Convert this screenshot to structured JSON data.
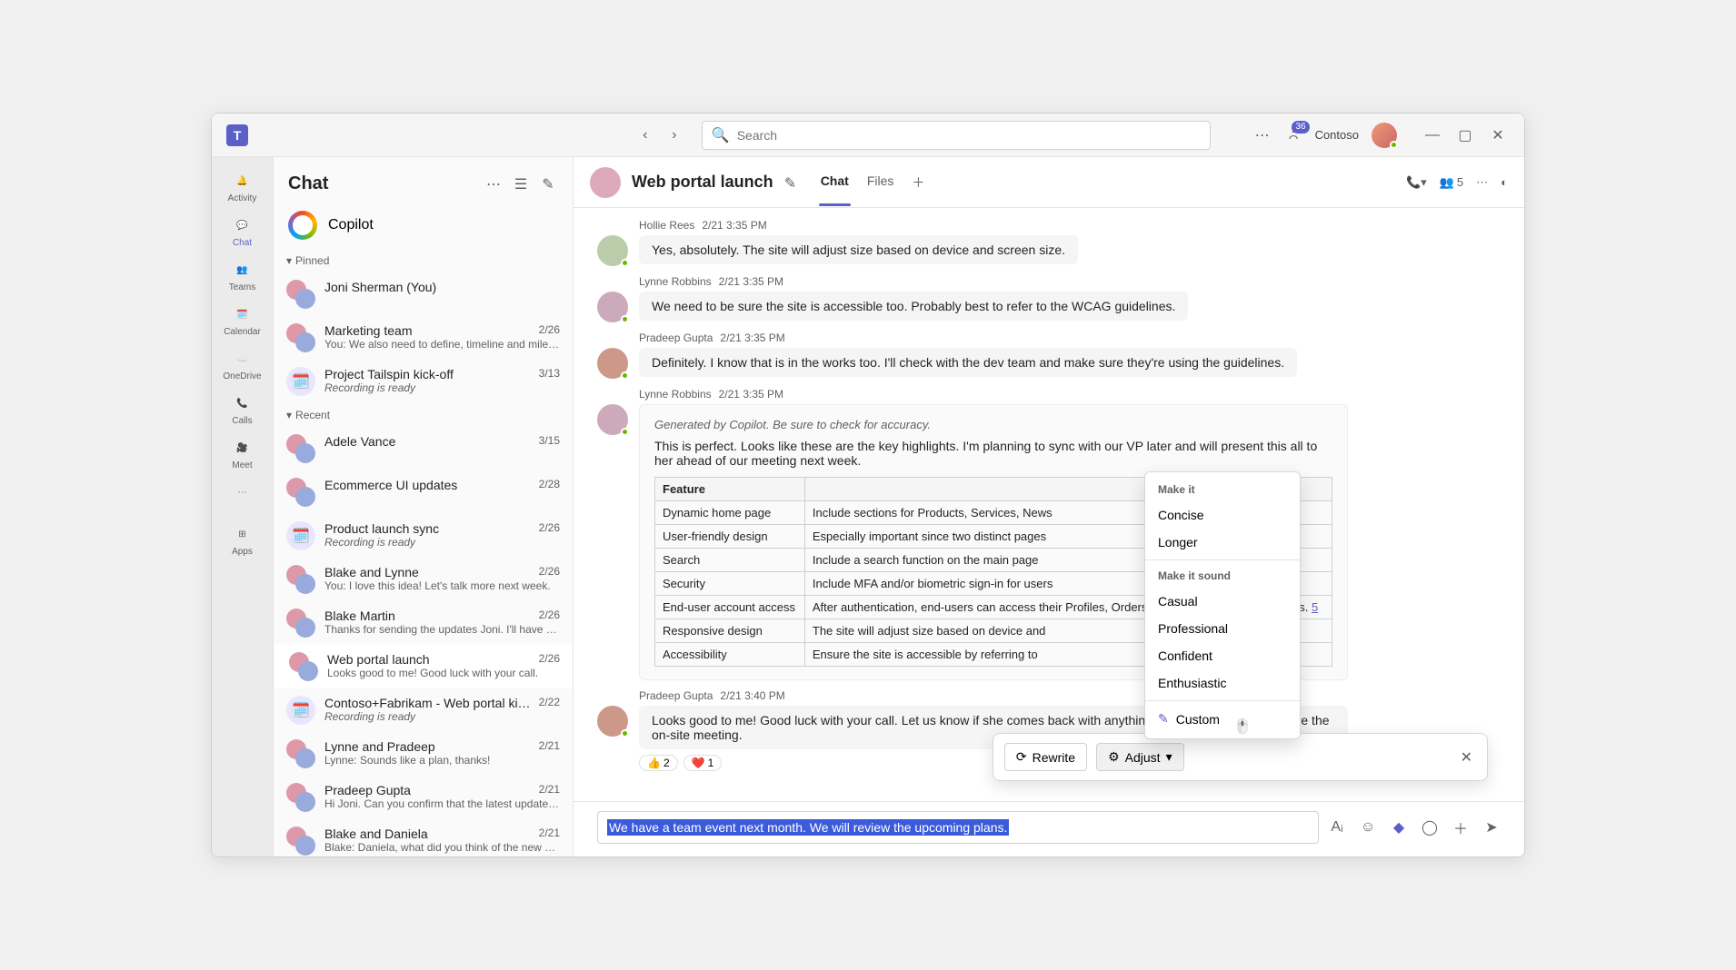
{
  "titlebar": {
    "search_placeholder": "Search",
    "tenant": "Contoso",
    "badge_count": "36"
  },
  "rail": {
    "activity": "Activity",
    "chat": "Chat",
    "teams": "Teams",
    "calendar": "Calendar",
    "onedrive": "OneDrive",
    "calls": "Calls",
    "meet": "Meet",
    "apps": "Apps"
  },
  "chatlist": {
    "title": "Chat",
    "copilot": "Copilot",
    "section_pinned": "Pinned",
    "section_recent": "Recent",
    "pinned": [
      {
        "title": "Joni Sherman (You)",
        "date": "",
        "sub": ""
      },
      {
        "title": "Marketing team",
        "date": "2/26",
        "sub": "You: We also need to define, timeline and miles…"
      },
      {
        "title": "Project Tailspin kick-off",
        "date": "3/13",
        "sub": "Recording is ready",
        "italic": true,
        "cal": true
      }
    ],
    "recent": [
      {
        "title": "Adele Vance",
        "date": "3/15",
        "sub": ""
      },
      {
        "title": "Ecommerce UI updates",
        "date": "2/28",
        "sub": ""
      },
      {
        "title": "Product launch sync",
        "date": "2/26",
        "sub": "Recording is ready",
        "italic": true,
        "cal": true
      },
      {
        "title": "Blake and Lynne",
        "date": "2/26",
        "sub": "You: I love this idea! Let's talk more next week."
      },
      {
        "title": "Blake Martin",
        "date": "2/26",
        "sub": "Thanks for sending the updates Joni. I'll have s…"
      },
      {
        "title": "Web portal launch",
        "date": "2/26",
        "sub": "Looks good to me! Good luck with your call.",
        "selected": true
      },
      {
        "title": "Contoso+Fabrikam - Web portal ki…",
        "date": "2/22",
        "sub": "Recording is ready",
        "italic": true,
        "cal": true
      },
      {
        "title": "Lynne and Pradeep",
        "date": "2/21",
        "sub": "Lynne: Sounds like a plan, thanks!"
      },
      {
        "title": "Pradeep Gupta",
        "date": "2/21",
        "sub": "Hi Joni. Can you confirm that the latest updates…"
      },
      {
        "title": "Blake and Daniela",
        "date": "2/21",
        "sub": "Blake: Daniela, what did you think of the new d…"
      }
    ]
  },
  "chat": {
    "title": "Web portal launch",
    "tab_chat": "Chat",
    "tab_files": "Files",
    "participants_count": "5"
  },
  "messages": [
    {
      "author": "Hollie Rees",
      "time": "2/21 3:35 PM",
      "text": "Yes, absolutely. The site will adjust size based on device and screen size."
    },
    {
      "author": "Lynne Robbins",
      "time": "2/21 3:35 PM",
      "text": "We need to be sure the site is accessible too. Probably best to refer to the WCAG guidelines."
    },
    {
      "author": "Pradeep Gupta",
      "time": "2/21 3:35 PM",
      "text": "Definitely. I know that is in the works too. I'll check with the dev team and make sure they're using the guidelines."
    }
  ],
  "copilot_msg": {
    "author": "Lynne Robbins",
    "time": "2/21 3:35 PM",
    "note": "Generated by Copilot. Be sure to check for accuracy.",
    "body": "This is perfect. Looks like these are the key highlights. I'm planning to sync with our VP later and will present this all to her ahead of our meeting next week.",
    "th_feature": "Feature",
    "th_desc": "",
    "rows": [
      {
        "f": "Dynamic home page",
        "d": "Include sections for Products, Services, News"
      },
      {
        "f": "User-friendly design",
        "d": "Especially important since two distinct pages"
      },
      {
        "f": "Search",
        "d": "Include a search function on the main page"
      },
      {
        "f": "Security",
        "d": "Include MFA and/or biometric sign-in for users"
      },
      {
        "f": "End-user account access",
        "d": "After authentication, end-users can access their Profiles, Orders, Invoices, and Support tickets. ",
        "link": "5"
      },
      {
        "f": "Responsive design",
        "d": "The site will adjust size based on device and"
      },
      {
        "f": "Accessibility",
        "d": "Ensure the site is accessible by referring to"
      }
    ]
  },
  "last_msg": {
    "author": "Pradeep Gupta",
    "time": "2/21 3:40 PM",
    "text": "Looks good to me! Good luck with your call. Let us know if she comes back with anything we can help answer before the on-site meeting.",
    "react1": "👍",
    "react1_c": "2",
    "react2": "❤️",
    "react2_c": "1"
  },
  "copilot_bar": {
    "rewrite": "Rewrite",
    "adjust": "Adjust"
  },
  "adjust_menu": {
    "hdr1": "Make it",
    "concise": "Concise",
    "longer": "Longer",
    "hdr2": "Make it sound",
    "casual": "Casual",
    "professional": "Professional",
    "confident": "Confident",
    "enthusiastic": "Enthusiastic",
    "custom": "Custom"
  },
  "compose": {
    "text": "We have a team event next month. We will review the upcoming plans."
  }
}
